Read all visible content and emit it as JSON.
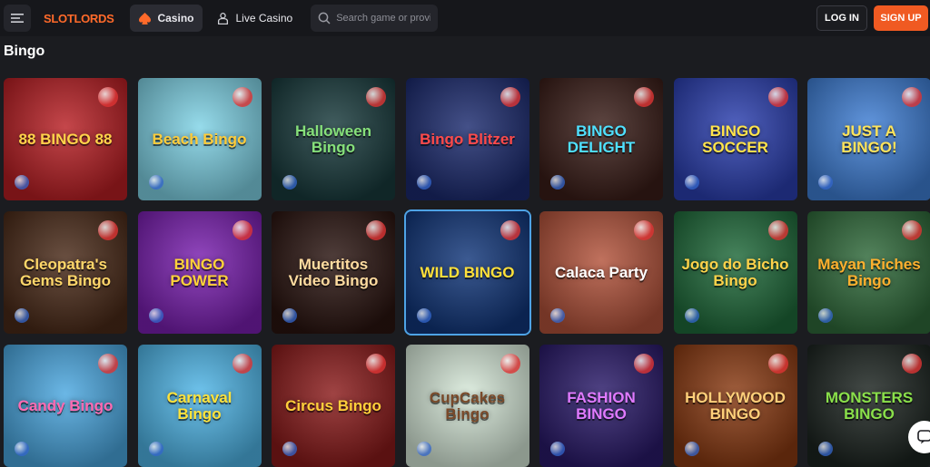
{
  "header": {
    "brand": "SLOTLORDS",
    "nav": [
      {
        "label": "Casino"
      },
      {
        "label": "Live Casino"
      }
    ],
    "search": {
      "placeholder": "Search game or provider"
    },
    "login_label": "LOG IN",
    "signup_label": "SIGN UP"
  },
  "section": {
    "title": "Bingo"
  },
  "games": [
    {
      "title": "88 BINGO 88",
      "bg": "#b81e23",
      "fg": "#ffd34a"
    },
    {
      "title": "Beach Bingo",
      "bg": "#7fd3e6",
      "fg": "#ffcc3a"
    },
    {
      "title": "Halloween Bingo",
      "bg": "#183a3c",
      "fg": "#86e07a"
    },
    {
      "title": "Bingo Blitzer",
      "bg": "#1b2a6e",
      "fg": "#ff4a4a"
    },
    {
      "title": "BINGO DELIGHT",
      "bg": "#3a1d18",
      "fg": "#4fe0ff"
    },
    {
      "title": "BINGO SOCCER",
      "bg": "#2b3fb0",
      "fg": "#ffe34a"
    },
    {
      "title": "JUST A BINGO!",
      "bg": "#3f7fd6",
      "fg": "#ffe45a"
    },
    {
      "title": "Cleopatra's Gems Bingo",
      "bg": "#4a2a18",
      "fg": "#ffd76a"
    },
    {
      "title": "BINGO POWER",
      "bg": "#7a1fb0",
      "fg": "#ffd23a"
    },
    {
      "title": "Muertitos Video Bingo",
      "bg": "#2a1410",
      "fg": "#ffdca0"
    },
    {
      "title": "WILD BINGO",
      "bg": "#11367a",
      "fg": "#ffe03a"
    },
    {
      "title": "Calaca Party",
      "bg": "#b2523a",
      "fg": "#ffffff"
    },
    {
      "title": "Jogo do Bicho Bingo",
      "bg": "#1f6a3a",
      "fg": "#ffd24a"
    },
    {
      "title": "Mayan Riches Bingo",
      "bg": "#2f6a3a",
      "fg": "#ffb02e"
    },
    {
      "title": "Candy Bingo",
      "bg": "#4aa7e0",
      "fg": "#ff6ab2"
    },
    {
      "title": "Carnaval Bingo",
      "bg": "#4fb6e8",
      "fg": "#ffe23a"
    },
    {
      "title": "Circus Bingo",
      "bg": "#8a1a1a",
      "fg": "#ffcf3a"
    },
    {
      "title": "CupCakes Bingo",
      "bg": "#d7e9d9",
      "fg": "#7a4a2a"
    },
    {
      "title": "FASHION BINGO",
      "bg": "#2a1a6a",
      "fg": "#e07aff"
    },
    {
      "title": "HOLLYWOOD BINGO",
      "bg": "#8a3a12",
      "fg": "#ffd07a"
    },
    {
      "title": "MONSTERS BINGO",
      "bg": "#1c2420",
      "fg": "#8ae04a"
    }
  ]
}
